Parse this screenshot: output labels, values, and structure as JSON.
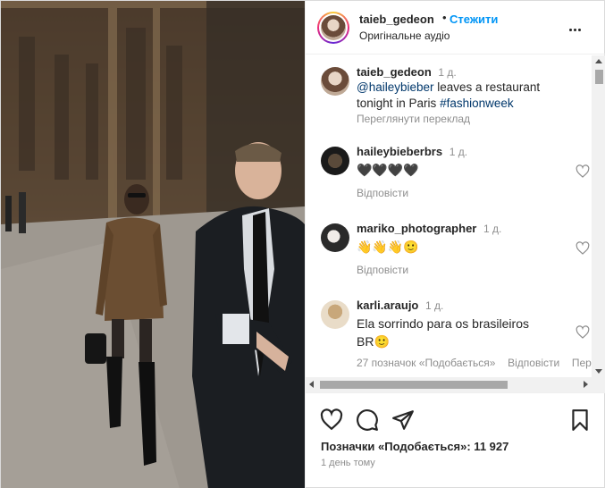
{
  "header": {
    "username": "taieb_gedeon",
    "separator": "•",
    "follow_label": "Стежити",
    "audio": "Оригінальне аудіо",
    "more_icon": "more-horizontal-icon"
  },
  "caption": {
    "username": "taieb_gedeon",
    "time": "1 д.",
    "mention": "@haileybieber",
    "text_1": " leaves a restaurant",
    "text_2": "tonight in Paris ",
    "hashtag": "#fashionweek",
    "translate": "Переглянути переклад"
  },
  "comments": [
    {
      "username": "haileybieberbrs",
      "time": "1 д.",
      "text": "🖤🖤🖤🖤",
      "reply": "Відповісти"
    },
    {
      "username": "mariko_photographer",
      "time": "1 д.",
      "text": "👋👋👋🙂",
      "reply": "Відповісти"
    },
    {
      "username": "karli.araujo",
      "time": "1 д.",
      "text_1": "Ela sorrindo para os brasileiros",
      "text_2": "BR🙂",
      "likes": "27 позначок «Подобається»",
      "reply": "Відповісти",
      "more": "Пер"
    }
  ],
  "actions": {
    "like_icon": "heart-icon",
    "comment_icon": "comment-icon",
    "share_icon": "share-icon",
    "save_icon": "bookmark-icon",
    "likes": "Позначки «Подобається»: 11 927",
    "time_ago": "1 день тому"
  },
  "colors": {
    "link": "#0095f6",
    "mention": "#00376b",
    "muted": "#8e8e8e",
    "text": "#262626"
  }
}
